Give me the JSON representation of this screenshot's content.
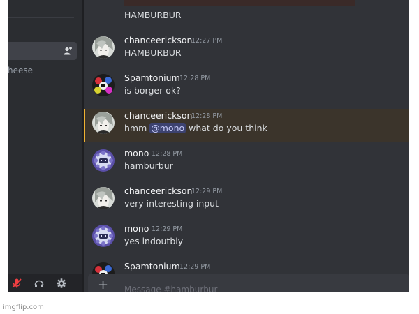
{
  "sidebar": {
    "partial_channel_text": "heese"
  },
  "chat": {
    "previous_message_text": "HAMBURBUR",
    "messages": [
      {
        "user": "chanceerickson",
        "time": "12:27 PM",
        "text": "HAMBURBUR"
      },
      {
        "user": "Spamtonium",
        "time": "12:28 PM",
        "text": "is borger ok?"
      },
      {
        "user": "chanceerickson",
        "time": "12:28 PM",
        "text_before": "hmm ",
        "mention": "@mono",
        "text_after": " what do you think",
        "highlighted": true
      },
      {
        "user": "mono",
        "time": "12:28 PM",
        "text": "hamburbur"
      },
      {
        "user": "chanceerickson",
        "time": "12:29 PM",
        "text": "very interesting input"
      },
      {
        "user": "mono",
        "time": "12:29 PM",
        "text": "yes indoutbly"
      },
      {
        "user": "Spamtonium",
        "time": "12:29 PM"
      }
    ]
  },
  "input": {
    "placeholder": "Message #hamburbur"
  },
  "footer": {
    "watermark": "imgflip.com"
  },
  "colors": {
    "chat_bg": "#313338",
    "sidebar_bg": "#2b2d31",
    "mention_highlight": "#f0b232",
    "mention_pill": "#3c4270"
  }
}
